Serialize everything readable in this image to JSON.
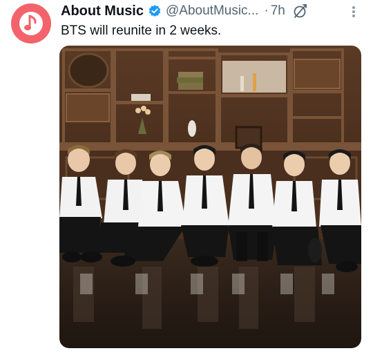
{
  "tweet": {
    "author": {
      "display_name": "About Music",
      "handle": "@AboutMusic...",
      "avatar_icon": "music-note-icon",
      "avatar_color": "#f2636b",
      "verified_icon": "verified-badge-icon",
      "verified_color": "#1d9bf0"
    },
    "separator": "·",
    "timestamp": "7h",
    "grok_icon": "grok-icon",
    "more_icon": "more-options-icon",
    "text": "BTS will reunite in 2 weeks.",
    "media": {
      "type": "photo",
      "members_count": 7
    }
  }
}
